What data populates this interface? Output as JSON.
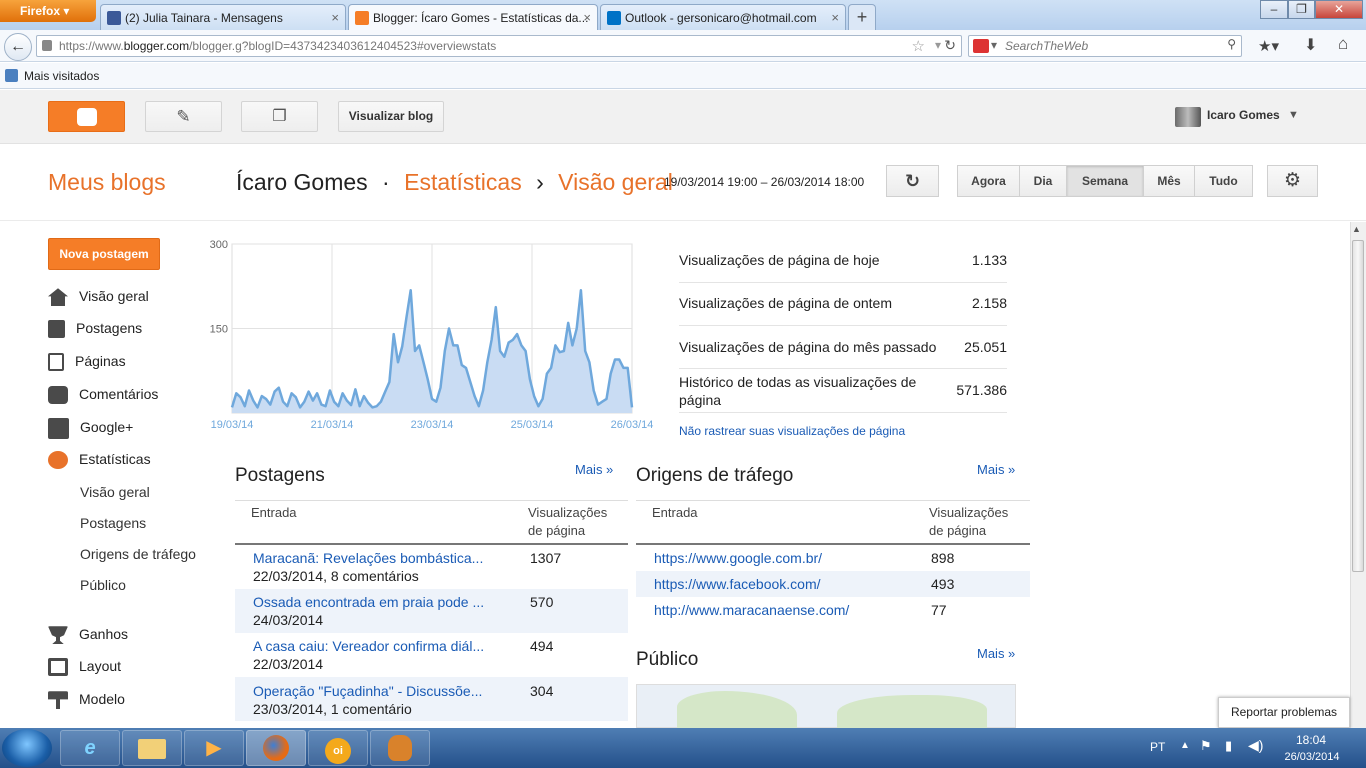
{
  "browser": {
    "menu_label": "Firefox",
    "tabs": [
      {
        "label": "(2) Julia Tainara - Mensagens",
        "icon": "facebook-icon",
        "color": "#3b5998"
      },
      {
        "label": "Blogger: Ícaro Gomes - Estatísticas da...",
        "icon": "blogger-icon",
        "color": "#f57d27"
      },
      {
        "label": "Outlook - gersonicaro@hotmail.com",
        "icon": "outlook-icon",
        "color": "#0072c6"
      }
    ],
    "new_tab": "+",
    "url_prefix": "https://www.",
    "url_domain": "blogger.com",
    "url_rest": "/blogger.g?blogID=4373423403612404523#overviewstats",
    "search_placeholder": "SearchTheWeb",
    "bookmark": "Mais visitados"
  },
  "header": {
    "view_blog": "Visualizar blog",
    "user_name": "Icaro Gomes"
  },
  "title": {
    "my_blogs": "Meus blogs",
    "blog_name": "Ícaro Gomes",
    "sep1": "·",
    "section": "Estatísticas",
    "sep2": "›",
    "page": "Visão geral",
    "date_range": "19/03/2014 19:00 – 26/03/2014 18:00",
    "ranges": [
      "Agora",
      "Dia",
      "Semana",
      "Mês",
      "Tudo"
    ],
    "active_range": "Semana"
  },
  "sidebar": {
    "new_post": "Nova postagem",
    "items": [
      {
        "label": "Visão geral",
        "icon": "home-icon"
      },
      {
        "label": "Postagens",
        "icon": "posts-icon"
      },
      {
        "label": "Páginas",
        "icon": "pages-icon"
      },
      {
        "label": "Comentários",
        "icon": "comments-icon"
      },
      {
        "label": "Google+",
        "icon": "google-plus-icon"
      },
      {
        "label": "Estatísticas",
        "icon": "stats-pie-icon"
      }
    ],
    "sub_items": [
      "Visão geral",
      "Postagens",
      "Origens de tráfego",
      "Público"
    ],
    "items2": [
      {
        "label": "Ganhos",
        "icon": "trophy-icon"
      },
      {
        "label": "Layout",
        "icon": "layout-icon"
      },
      {
        "label": "Modelo",
        "icon": "paint-roller-icon"
      }
    ]
  },
  "chart_data": {
    "type": "area",
    "ylim": [
      0,
      300
    ],
    "yticks": [
      "300",
      "150"
    ],
    "xticks": [
      "19/03/14",
      "21/03/14",
      "23/03/14",
      "25/03/14",
      "26/03/14"
    ],
    "color": "#6fa8dc",
    "x_start": "19/03/2014 19:00",
    "x_step_hours": 2,
    "values": [
      10,
      35,
      28,
      12,
      40,
      22,
      10,
      30,
      25,
      15,
      38,
      45,
      20,
      12,
      35,
      28,
      10,
      20,
      38,
      22,
      35,
      15,
      12,
      40,
      20,
      12,
      35,
      22,
      14,
      42,
      12,
      30,
      18,
      10,
      12,
      20,
      38,
      55,
      140,
      90,
      118,
      170,
      218,
      110,
      120,
      90,
      60,
      25,
      20,
      45,
      110,
      150,
      120,
      120,
      85,
      80,
      55,
      30,
      12,
      40,
      90,
      130,
      188,
      110,
      100,
      125,
      130,
      140,
      120,
      110,
      60,
      30,
      12,
      25,
      70,
      80,
      120,
      108,
      110,
      160,
      120,
      150,
      218,
      110,
      90,
      40,
      15,
      20,
      25,
      70,
      95,
      95,
      80,
      80,
      10
    ]
  },
  "stats": {
    "rows": [
      {
        "label": "Visualizações de página de hoje",
        "value": "1.133"
      },
      {
        "label": "Visualizações de página de ontem",
        "value": "2.158"
      },
      {
        "label": "Visualizações de página do mês passado",
        "value": "25.051"
      },
      {
        "label": "Histórico de todas as visualizações de página",
        "value": "571.386"
      }
    ],
    "dont_track": "Não rastrear suas visualizações de página"
  },
  "posts": {
    "title": "Postagens",
    "more": "Mais »",
    "col_entry": "Entrada",
    "col_views": "Visualizações de página",
    "rows": [
      {
        "title": "Maracanã: Revelações bombástica...",
        "meta": "22/03/2014, 8 comentários",
        "views": "1307"
      },
      {
        "title": "Ossada encontrada em praia pode ...",
        "meta": "24/03/2014",
        "views": "570"
      },
      {
        "title": "A casa caiu: Vereador confirma diál...",
        "meta": "22/03/2014",
        "views": "494"
      },
      {
        "title": "Operação \"Fuçadinha\" - Discussõe...",
        "meta": "23/03/2014, 1 comentário",
        "views": "304"
      }
    ]
  },
  "traffic": {
    "title": "Origens de tráfego",
    "more": "Mais »",
    "col_entry": "Entrada",
    "col_views": "Visualizações de página",
    "rows": [
      {
        "url": "https://www.google.com.br/",
        "views": "898"
      },
      {
        "url": "https://www.facebook.com/",
        "views": "493"
      },
      {
        "url": "http://www.maracanaense.com/",
        "views": "77"
      }
    ]
  },
  "audience": {
    "title": "Público",
    "more": "Mais »"
  },
  "report_problems": "Reportar problemas",
  "taskbar": {
    "lang": "PT",
    "time": "18:04",
    "date": "26/03/2014"
  }
}
